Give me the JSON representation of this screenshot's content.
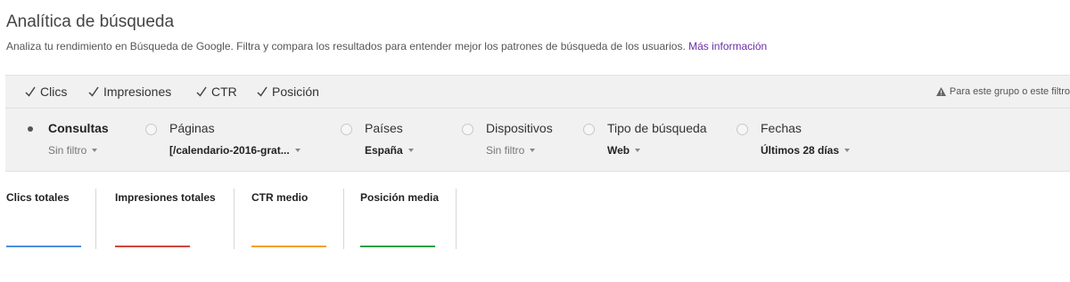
{
  "header": {
    "title": "Analítica de búsqueda",
    "description": "Analiza tu rendimiento en Búsqueda de Google. Filtra y compara los resultados para entender mejor los patrones de búsqueda de los usuarios.",
    "more_link": "Más información"
  },
  "metrics": {
    "items": [
      {
        "label": "Clics",
        "checked": true
      },
      {
        "label": "Impresiones",
        "checked": true
      },
      {
        "label": "CTR",
        "checked": true
      },
      {
        "label": "Posición",
        "checked": true
      }
    ],
    "group_note": "Para este grupo o este filtro"
  },
  "dimensions": {
    "items": [
      {
        "label": "Consultas",
        "filter": "Sin filtro",
        "selected": true
      },
      {
        "label": "Páginas",
        "filter": "[/calendario-2016-grat...",
        "selected": false
      },
      {
        "label": "Países",
        "filter": "España",
        "selected": false
      },
      {
        "label": "Dispositivos",
        "filter": "Sin filtro",
        "selected": false
      },
      {
        "label": "Tipo de búsqueda",
        "filter": "Web",
        "selected": false
      },
      {
        "label": "Fechas",
        "filter": "Últimos 28 días",
        "selected": false
      }
    ]
  },
  "totals": {
    "items": [
      {
        "label": "Clics totales",
        "color": "#4a90e2"
      },
      {
        "label": "Impresiones totales",
        "color": "#d0453b"
      },
      {
        "label": "CTR medio",
        "color": "#f4a12c"
      },
      {
        "label": "Posición media",
        "color": "#2e9e44"
      }
    ]
  },
  "colors": {
    "link": "#6a2da8",
    "panel_bg": "#f1f1f1"
  }
}
